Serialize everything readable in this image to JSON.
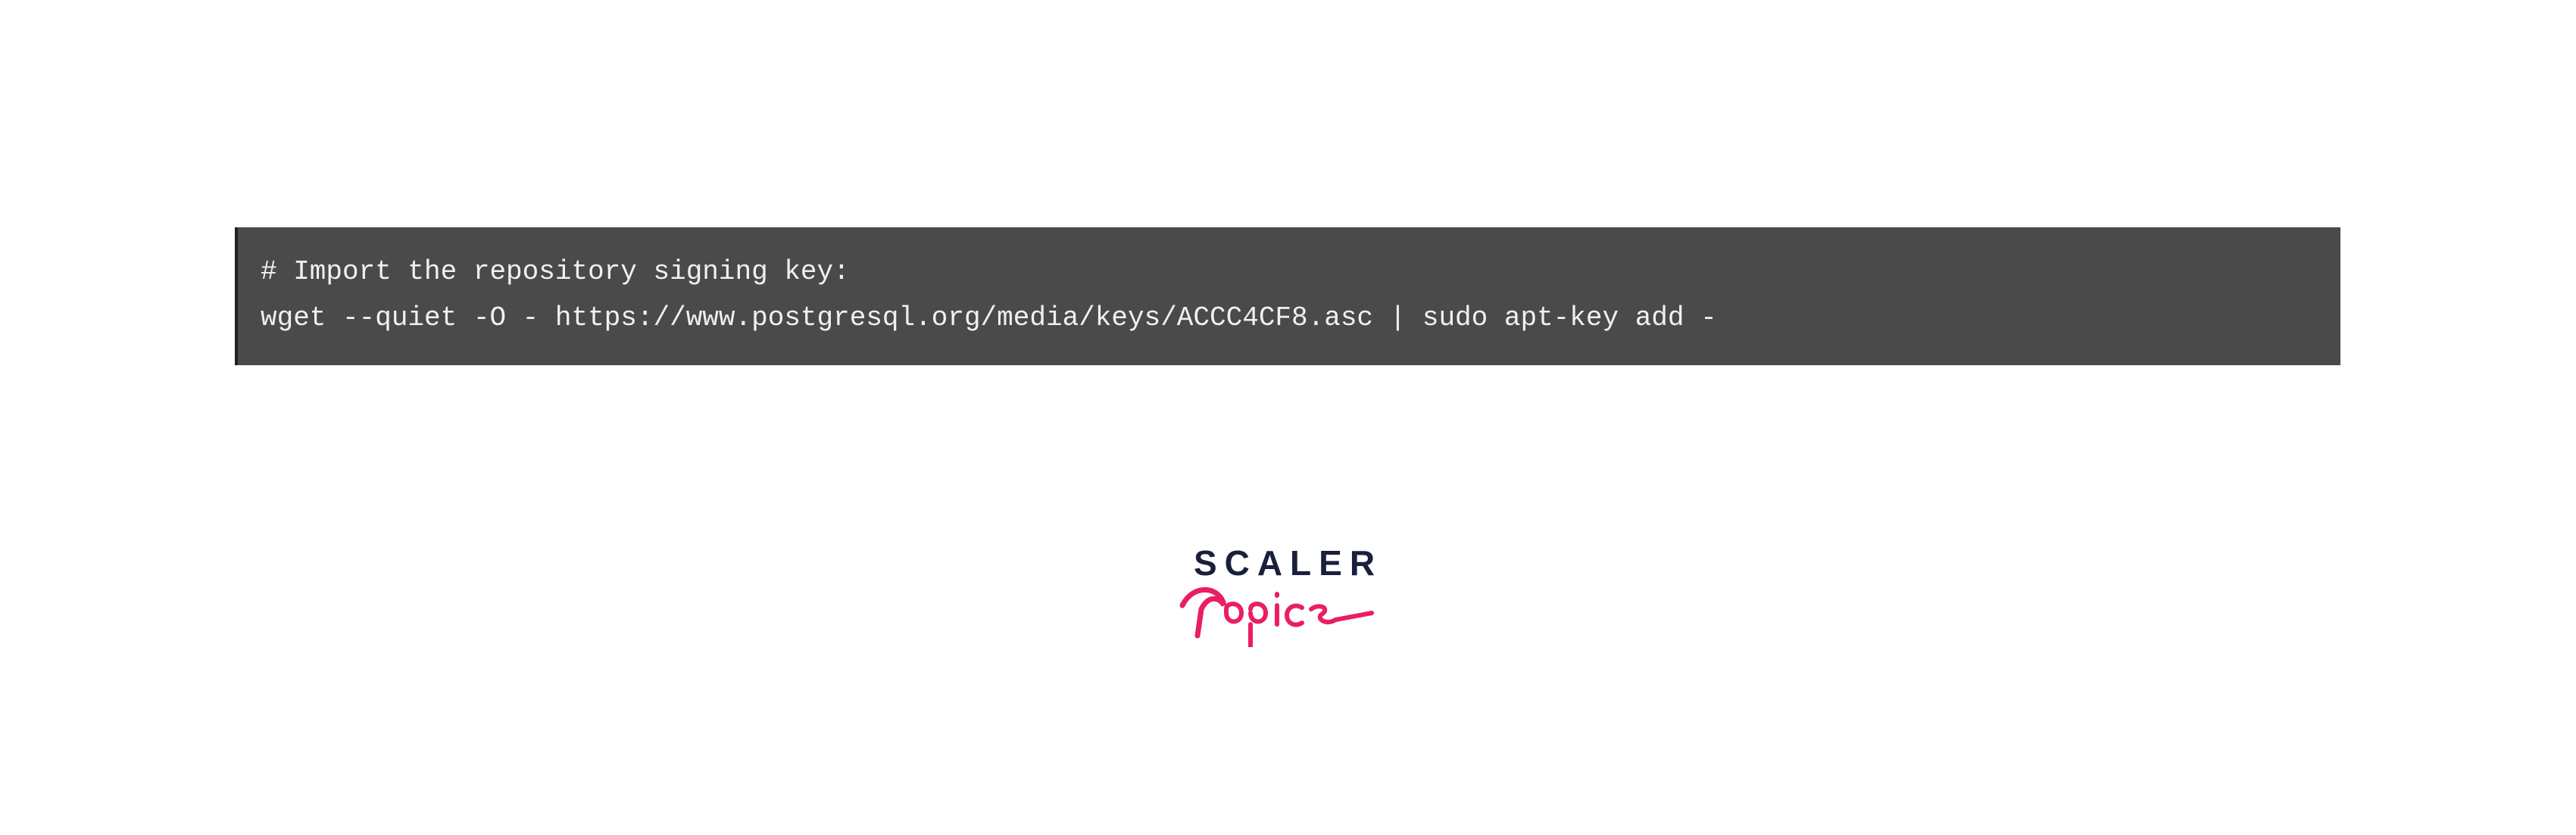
{
  "code": {
    "line1": "# Import the repository signing key:",
    "line2": "wget --quiet -O - https://www.postgresql.org/media/keys/ACCC4CF8.asc | sudo apt-key add -"
  },
  "logo": {
    "primary": "SCALER",
    "secondary": "Topics",
    "primaryColor": "#1a1f3a",
    "secondaryColor": "#e91e63"
  }
}
